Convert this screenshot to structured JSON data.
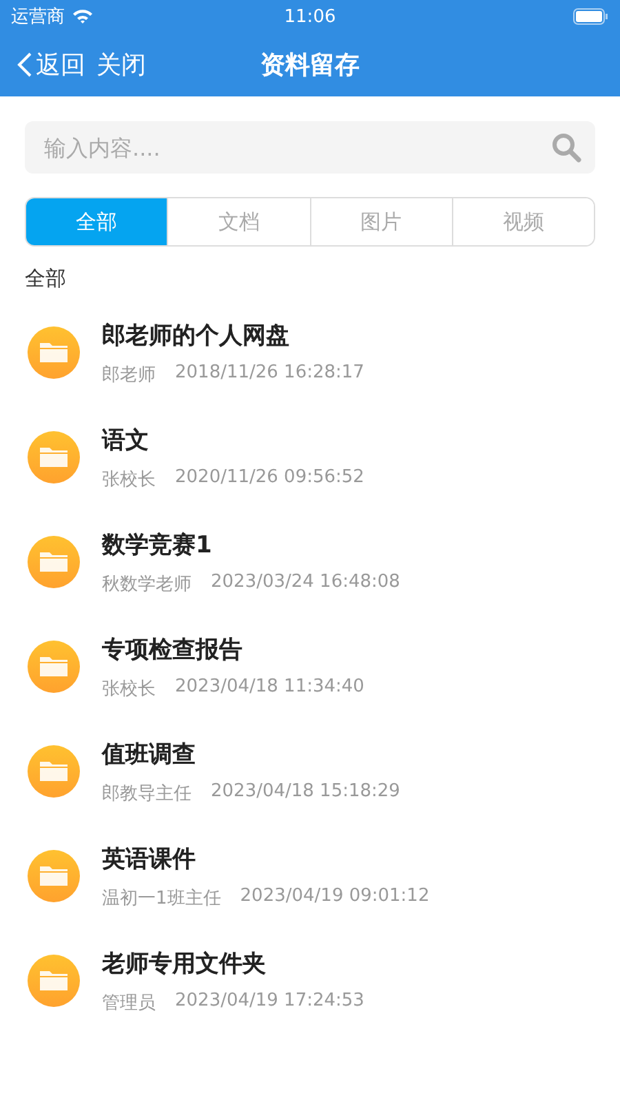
{
  "status_bar": {
    "carrier": "运营商",
    "time": "11:06"
  },
  "nav": {
    "back": "返回",
    "close": "关闭",
    "title": "资料留存"
  },
  "search": {
    "placeholder": "输入内容...."
  },
  "tabs": [
    {
      "label": "全部",
      "selected": true
    },
    {
      "label": "文档",
      "selected": false
    },
    {
      "label": "图片",
      "selected": false
    },
    {
      "label": "视频",
      "selected": false
    }
  ],
  "section_label": "全部",
  "folders": [
    {
      "name": "郎老师的个人网盘",
      "owner": "郎老师",
      "time": "2018/11/26 16:28:17"
    },
    {
      "name": "语文",
      "owner": "张校长",
      "time": "2020/11/26 09:56:52"
    },
    {
      "name": "数学竞赛1",
      "owner": "秋数学老师",
      "time": "2023/03/24 16:48:08"
    },
    {
      "name": "专项检查报告",
      "owner": "张校长",
      "time": "2023/04/18 11:34:40"
    },
    {
      "name": "值班调查",
      "owner": "郎教导主任",
      "time": "2023/04/18 15:18:29"
    },
    {
      "name": "英语课件",
      "owner": "温初一1班主任",
      "time": "2023/04/19 09:01:12"
    },
    {
      "name": "老师专用文件夹",
      "owner": "管理员",
      "time": "2023/04/19 17:24:53"
    }
  ]
}
